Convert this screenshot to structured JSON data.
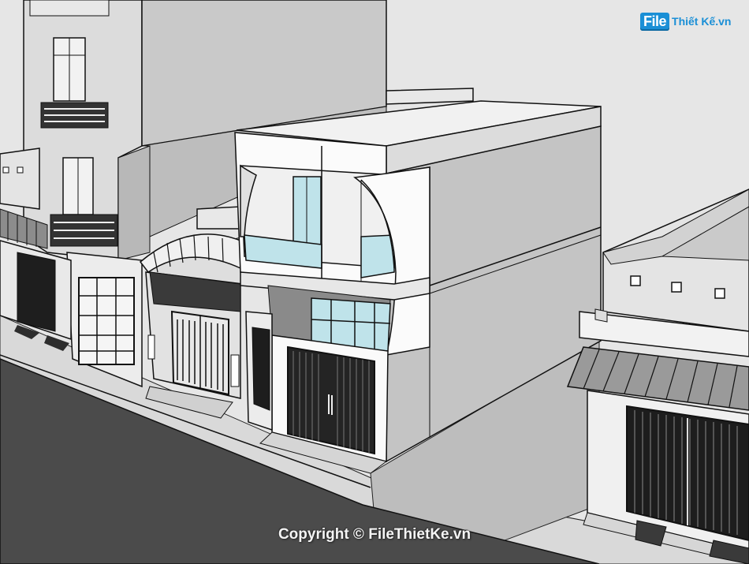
{
  "watermark": {
    "logo_mark": "File",
    "logo_text": "Thiết Kế.vn",
    "copyright": "Copyright © FileThietKe.vn"
  },
  "colors": {
    "sky": "#e6e6e6",
    "road": "#4a4a4a",
    "glass": "#bfe3ea",
    "outline": "#1a1a1a",
    "brand": "#1a8fd6"
  }
}
